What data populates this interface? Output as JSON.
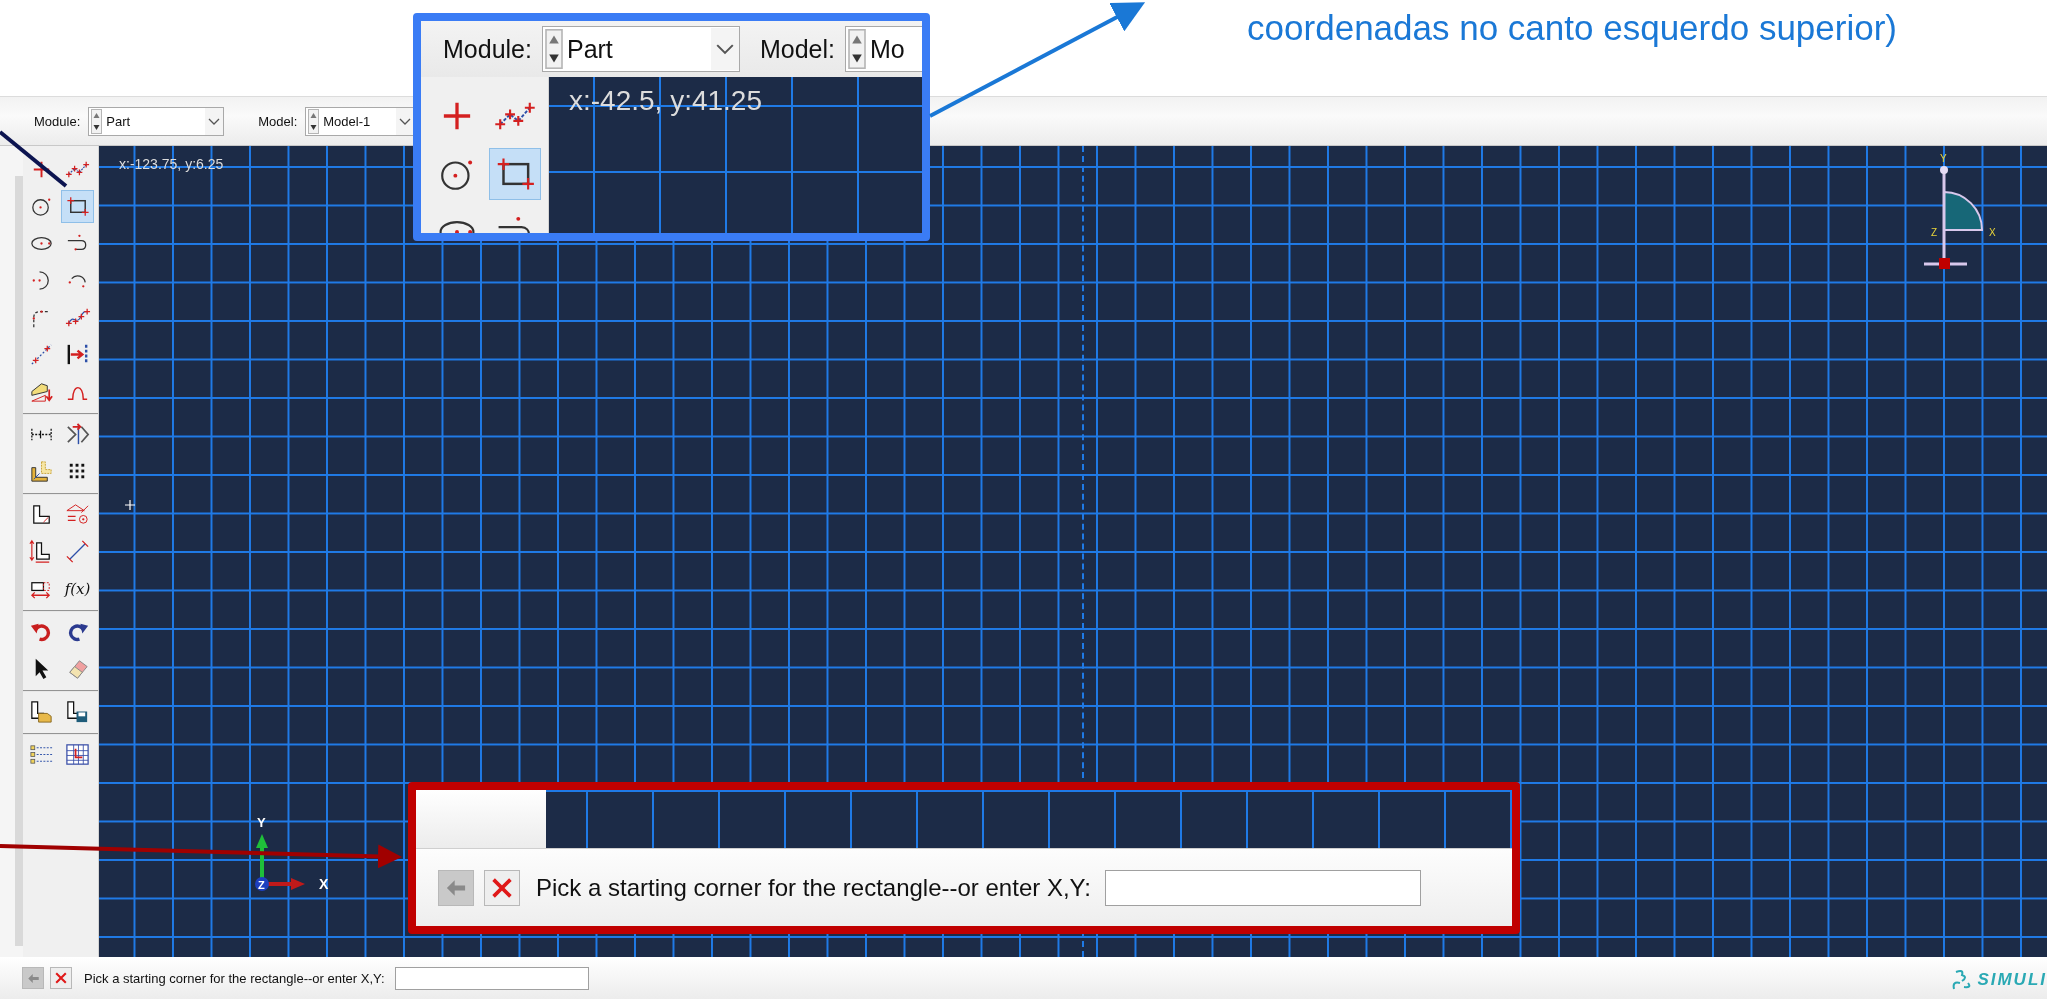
{
  "annotation": {
    "text": "coordenadas no canto esquerdo superior)"
  },
  "toolbar": {
    "module": {
      "label": "Module:",
      "value": "Part"
    },
    "model": {
      "label": "Model:",
      "value": "Model-1"
    }
  },
  "toolbox": {
    "groups": [
      {
        "tools": [
          {
            "kind": "point",
            "selected": false
          },
          {
            "kind": "connected-lines",
            "selected": false
          },
          {
            "kind": "circle",
            "selected": false
          },
          {
            "kind": "rectangle",
            "selected": true
          },
          {
            "kind": "ellipse",
            "selected": false
          },
          {
            "kind": "spline",
            "selected": false
          },
          {
            "kind": "arc-center",
            "selected": false
          },
          {
            "kind": "arc-3pt",
            "selected": false
          },
          {
            "kind": "fillet",
            "selected": false
          },
          {
            "kind": "spline-points",
            "selected": false
          },
          {
            "kind": "construction",
            "selected": false
          },
          {
            "kind": "offset",
            "selected": false
          },
          {
            "kind": "project",
            "selected": false
          },
          {
            "kind": "bump",
            "selected": false
          }
        ]
      },
      {
        "tools": [
          {
            "kind": "split",
            "selected": false
          },
          {
            "kind": "mirror",
            "selected": false
          },
          {
            "kind": "sketch-options",
            "selected": false
          },
          {
            "kind": "dot-grid",
            "selected": false
          }
        ]
      },
      {
        "tools": [
          {
            "kind": "dimension",
            "selected": false
          },
          {
            "kind": "constraint",
            "selected": false
          },
          {
            "kind": "dimension-edit",
            "selected": false
          },
          {
            "kind": "distance",
            "selected": false
          },
          {
            "kind": "edit-dimension",
            "selected": false
          },
          {
            "kind": "function",
            "label": "f(x)",
            "selected": false
          }
        ]
      },
      {
        "tools": [
          {
            "kind": "undo",
            "selected": false
          },
          {
            "kind": "redo",
            "selected": false
          },
          {
            "kind": "select",
            "selected": false
          },
          {
            "kind": "eraser",
            "selected": false
          }
        ]
      },
      {
        "tools": [
          {
            "kind": "open",
            "selected": false
          },
          {
            "kind": "save",
            "selected": false
          }
        ]
      },
      {
        "tools": [
          {
            "kind": "list",
            "selected": false
          },
          {
            "kind": "table",
            "selected": false
          }
        ]
      }
    ]
  },
  "viewport": {
    "coordinates": "x:-123.75, y:6.25",
    "view_triad": {
      "x": "X",
      "y": "Y",
      "z": "Z"
    },
    "triad": {
      "x": "X",
      "y": "Y",
      "z": "Z"
    }
  },
  "prompt": {
    "text": "Pick a starting corner for the rectangle--or enter X,Y:"
  },
  "logo": {
    "text": "SIMULI"
  },
  "zoom_callout": {
    "module": {
      "label": "Module:",
      "value": "Part"
    },
    "model": {
      "label": "Model:",
      "value": "Mo"
    },
    "coordinates": "x:-42.5, y:41.25",
    "tools": [
      {
        "kind": "point",
        "selected": false
      },
      {
        "kind": "connected-lines",
        "selected": false
      },
      {
        "kind": "circle",
        "selected": false
      },
      {
        "kind": "rectangle",
        "selected": true
      },
      {
        "kind": "ellipse",
        "selected": false
      },
      {
        "kind": "spline",
        "selected": false
      }
    ]
  },
  "prompt_callout": {
    "text": "Pick a starting corner for the rectangle--or enter X,Y:"
  }
}
